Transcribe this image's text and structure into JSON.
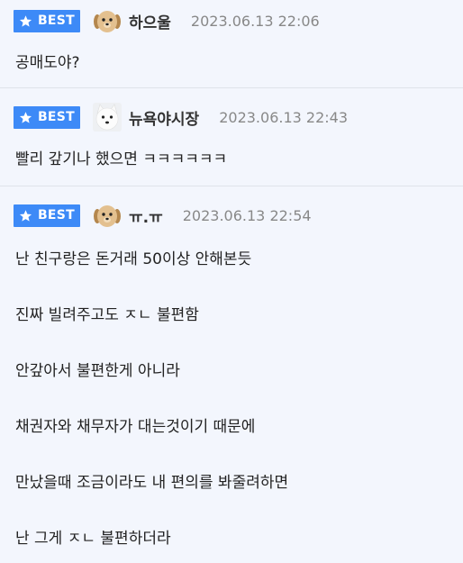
{
  "comments": [
    {
      "badge": "BEST",
      "avatar": "puppy-icon",
      "nick": "하으울",
      "date": "2023.06.13 22:06",
      "lines": [
        "공매도야?"
      ]
    },
    {
      "badge": "BEST",
      "avatar": "white-dog-icon",
      "nick": "뉴욕야시장",
      "date": "2023.06.13 22:43",
      "lines": [
        "빨리 갚기나 했으면 ㅋㅋㅋㅋㅋㅋ"
      ]
    },
    {
      "badge": "BEST",
      "avatar": "puppy-icon",
      "nick": "ㅠ.ㅠ",
      "date": "2023.06.13 22:54",
      "lines": [
        "난 친구랑은 돈거래 50이상 안해본듯",
        "진짜 빌려주고도 ㅈㄴ 불편함",
        "안갚아서 불편한게 아니라",
        "채권자와 채무자가 대는것이기 때문에",
        "만났을때 조금이라도 내 편의를 봐줄려하면",
        "난 그게 ㅈㄴ 불편하더라"
      ]
    }
  ],
  "colors": {
    "badge": "#3d8af7",
    "background": "#f3f6fd",
    "divider": "#dfe3ea"
  }
}
